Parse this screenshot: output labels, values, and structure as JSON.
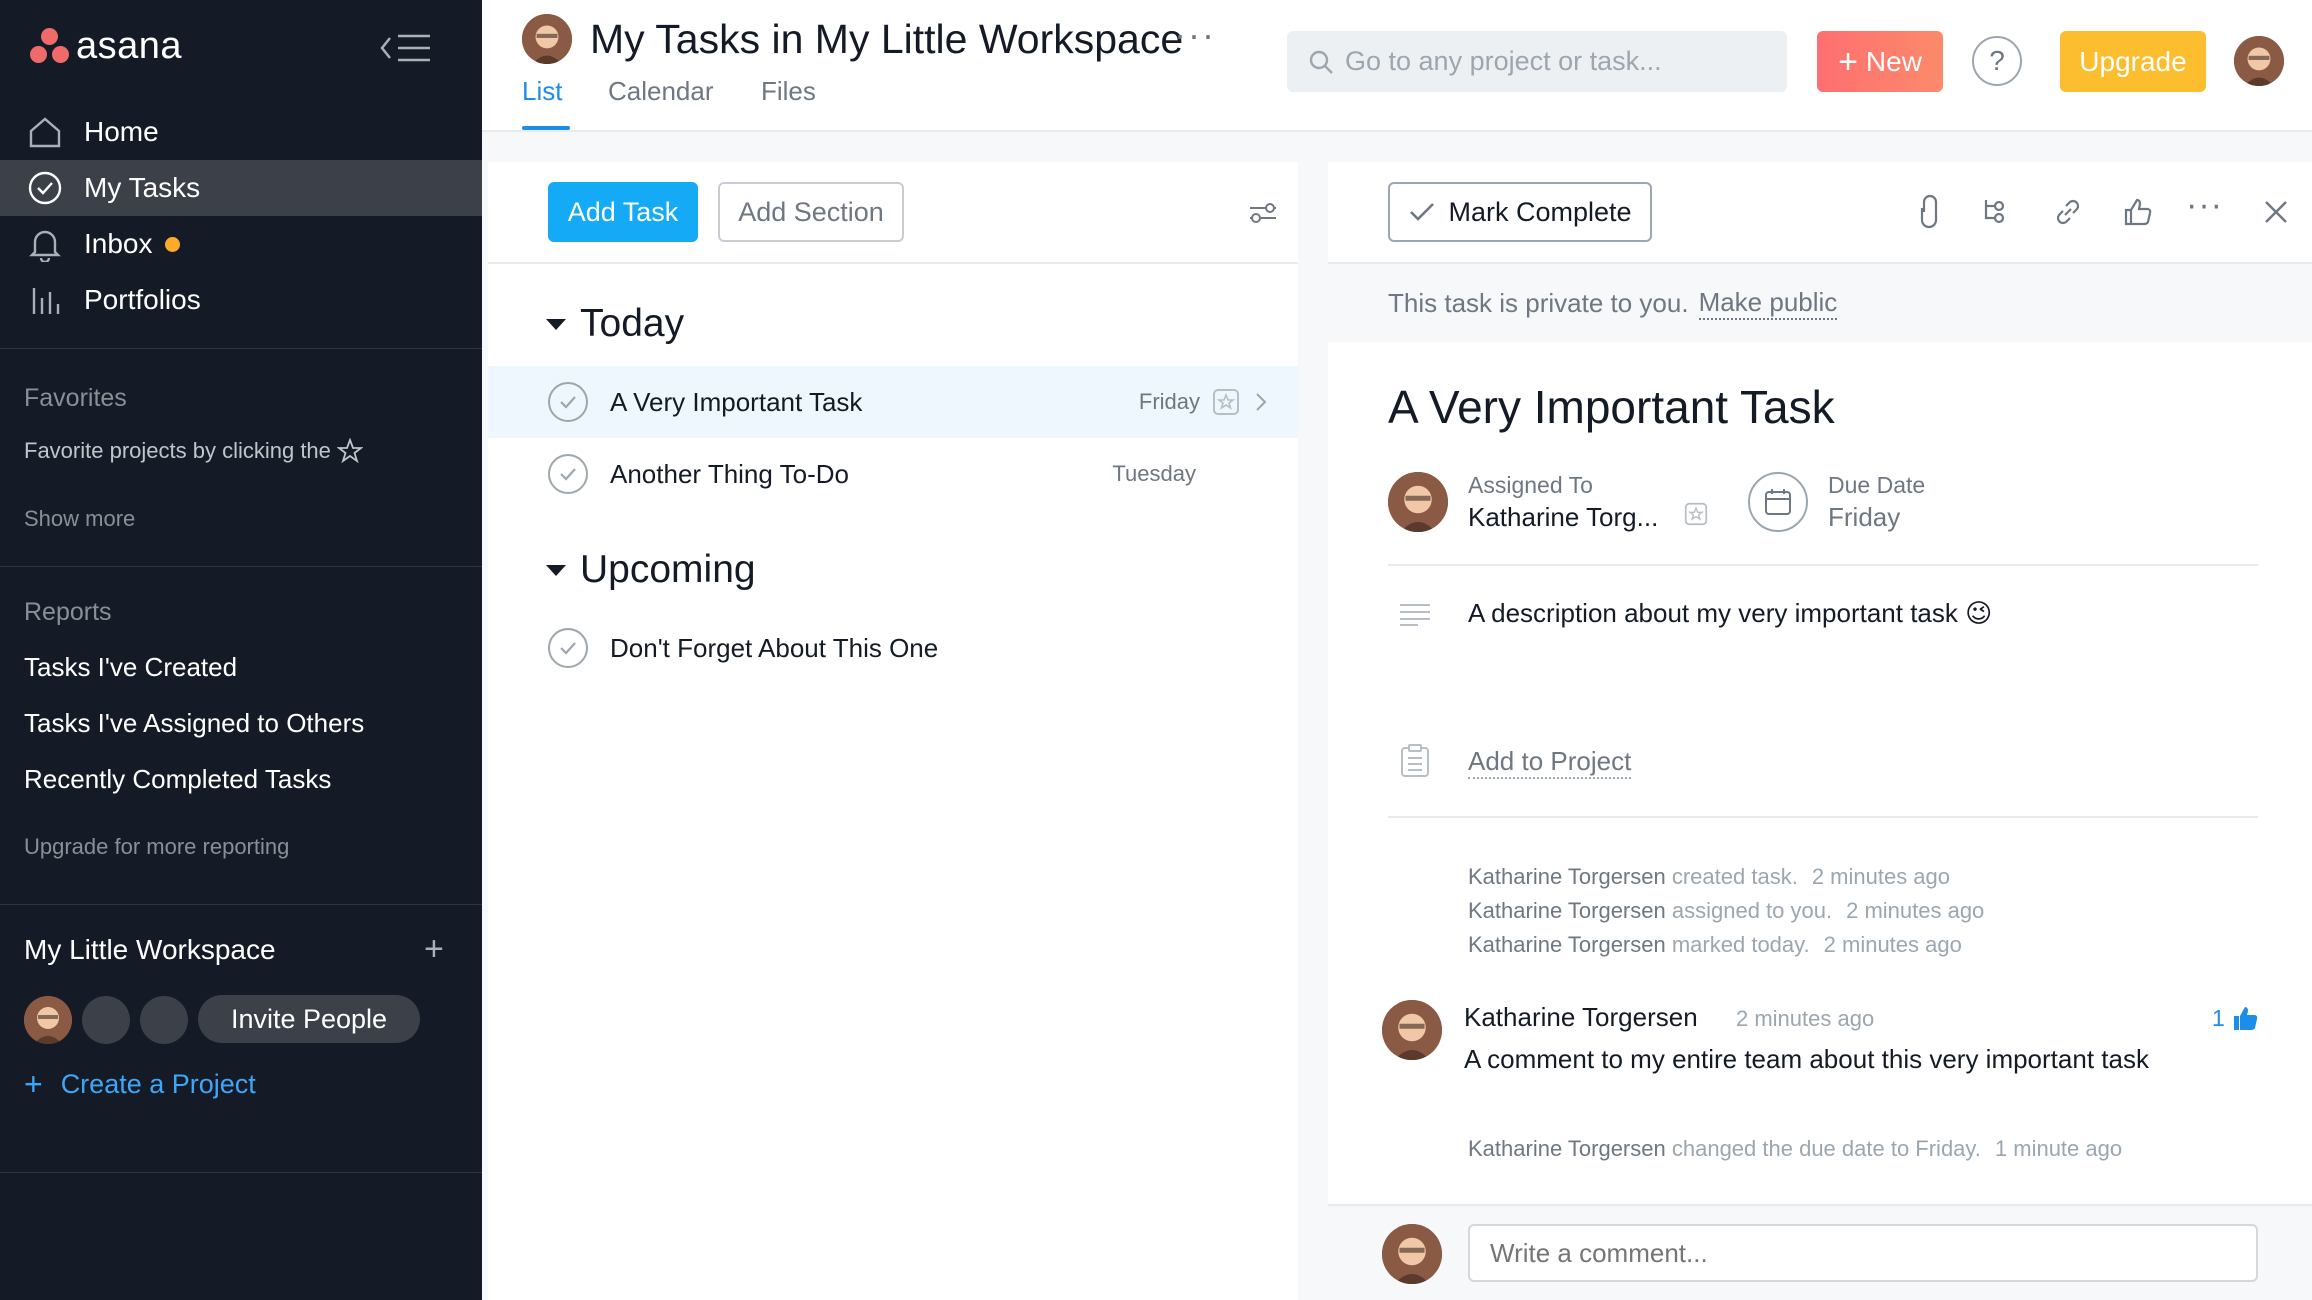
{
  "app": {
    "name": "asana"
  },
  "sidebar": {
    "nav": [
      {
        "label": "Home",
        "icon": "home-icon"
      },
      {
        "label": "My Tasks",
        "icon": "check-circle-icon"
      },
      {
        "label": "Inbox",
        "icon": "bell-icon"
      },
      {
        "label": "Portfolios",
        "icon": "bar-chart-icon"
      }
    ],
    "favorites": {
      "heading": "Favorites",
      "hint": "Favorite projects by clicking the",
      "show_more": "Show more"
    },
    "reports": {
      "heading": "Reports",
      "items": [
        "Tasks I've Created",
        "Tasks I've Assigned to Others",
        "Recently Completed Tasks"
      ],
      "upgrade_hint": "Upgrade for more reporting"
    },
    "workspace": {
      "name": "My Little Workspace",
      "invite_label": "Invite People",
      "create_label": "Create a Project"
    }
  },
  "header": {
    "title": "My Tasks in My Little Workspace",
    "tabs": [
      "List",
      "Calendar",
      "Files"
    ],
    "active_tab": "List",
    "search_placeholder": "Go to any project or task...",
    "new_label": "New",
    "help_label": "?",
    "upgrade_label": "Upgrade"
  },
  "list": {
    "add_task": "Add Task",
    "add_section": "Add Section",
    "sections": [
      {
        "name": "Today",
        "tasks": [
          {
            "name": "A Very Important Task",
            "due": "Friday"
          },
          {
            "name": "Another Thing To-Do",
            "due": "Tuesday"
          }
        ]
      },
      {
        "name": "Upcoming",
        "tasks": [
          {
            "name": "Don't Forget About This One",
            "due": ""
          }
        ]
      }
    ]
  },
  "detail": {
    "mark_complete": "Mark Complete",
    "privacy_text": "This task is private to you.",
    "make_public": "Make public",
    "title": "A Very Important Task",
    "assigned_label": "Assigned To",
    "assignee": "Katharine Torg...",
    "due_label": "Due Date",
    "due_value": "Friday",
    "description": "A description about my very important task 😉",
    "add_to_project": "Add to Project",
    "stories": [
      {
        "user": "Katharine Torgersen",
        "action": "created task.",
        "time": "2 minutes ago"
      },
      {
        "user": "Katharine Torgersen",
        "action": "assigned to you.",
        "time": "2 minutes ago"
      },
      {
        "user": "Katharine Torgersen",
        "action": "marked today.",
        "time": "2 minutes ago"
      }
    ],
    "comment": {
      "user": "Katharine Torgersen",
      "time": "2 minutes ago",
      "text": "A comment to my entire team about this very important task",
      "likes": "1"
    },
    "last_story": {
      "user": "Katharine Torgersen",
      "action": "changed the due date to Friday.",
      "time": "1 minute ago"
    },
    "comment_placeholder": "Write a comment..."
  },
  "colors": {
    "sidebar_bg": "#151b26",
    "accent_blue": "#14aaf5",
    "new_button": "#ff6f71",
    "upgrade_button": "#fcbd2e",
    "inbox_dot": "#fcaa2a"
  }
}
